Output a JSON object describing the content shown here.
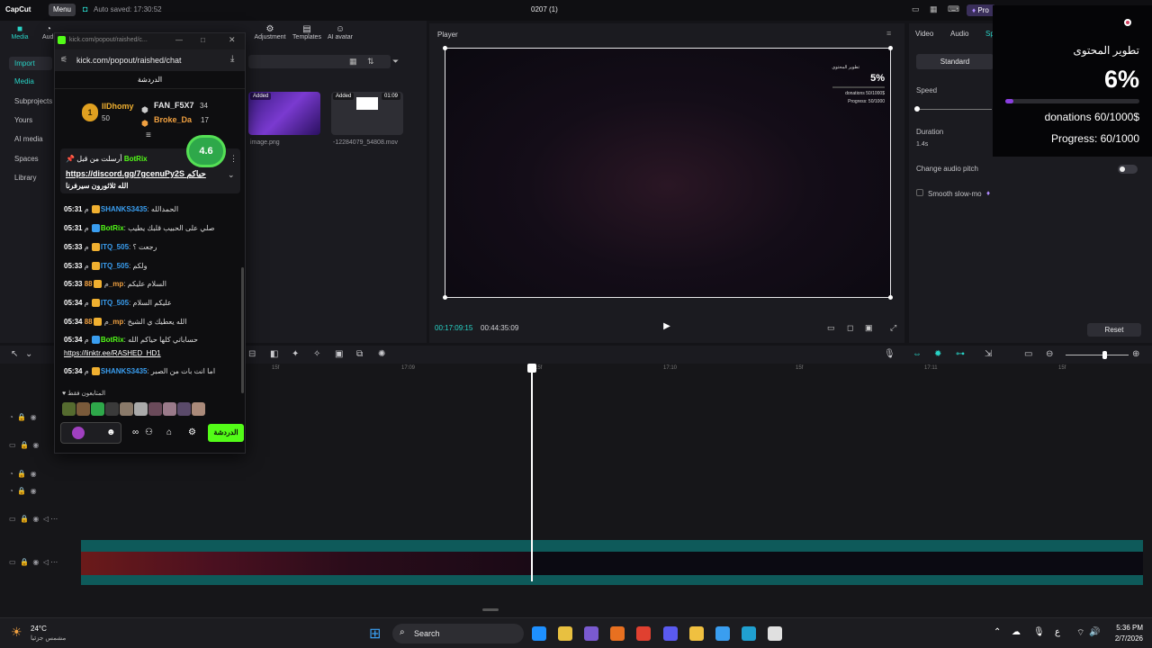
{
  "titlebar": {
    "app_name": "CapCut",
    "menu_label": "Menu",
    "autosave": "Auto saved: 17:30:52",
    "project_title": "0207 (1)",
    "pro_label": "Pro"
  },
  "toolbar": {
    "items": [
      {
        "label": "Media",
        "icon": "media-icon"
      },
      {
        "label": "Audi",
        "icon": "audio-icon"
      },
      {
        "label": "Adjustment",
        "icon": "adjustment-icon"
      },
      {
        "label": "Templates",
        "icon": "templates-icon"
      },
      {
        "label": "AI avatar",
        "icon": "ai-avatar-icon"
      }
    ]
  },
  "leftnav": {
    "items": [
      "Import",
      "Media",
      "Subprojects",
      "Yours",
      "AI media",
      "Spaces",
      "Library"
    ]
  },
  "media": {
    "thumbs": [
      {
        "badge": "Added",
        "name": "image.png",
        "duration": "",
        "color": "#5a2aa0"
      },
      {
        "badge": "Added",
        "name": "-12284079_54808.mov",
        "duration": "01:09",
        "color": "#2a2a30"
      }
    ]
  },
  "player": {
    "label": "Player",
    "current_time": "00:17:09:15",
    "total_time": "00:44:35:09",
    "preview": {
      "title": "تطوير المحتوى",
      "percent": "5%",
      "donations": "donations 50/1000$",
      "progress": "Progress: 50/1000"
    }
  },
  "rightpanel": {
    "tabs": [
      "Video",
      "Audio",
      "Sp"
    ],
    "standard_label": "Standard",
    "speed_label": "Speed",
    "duration_label": "Duration",
    "duration_value": "1.4s",
    "audio_pitch_label": "Change audio pitch",
    "smooth_label": "Smooth slow-mo",
    "reset_label": "Reset"
  },
  "overlay": {
    "title": "تطوير المحتوى",
    "percent": "6%",
    "progress_fraction": 0.06,
    "donations": "donations 60/1000$",
    "progress": "Progress: 60/1000",
    "bar_color": "#8a3ee0"
  },
  "timeline": {
    "ruler": [
      "15f",
      "17:09",
      "15f",
      "17:10",
      "15f",
      "17:11",
      "15f"
    ]
  },
  "chat": {
    "small_url": "kick.com/popout/raished/c...",
    "url": "kick.com/popout/raished/chat",
    "header": "الدردشة",
    "leaderboard": [
      {
        "rank": "1",
        "name": "IIDhomy",
        "count": "50",
        "color": "#f0b030"
      },
      {
        "rank": "",
        "name": "FAN_F5X7",
        "count": "34",
        "color": "#e8e8ea"
      },
      {
        "rank": "",
        "name": "Broke_Da",
        "count": "17",
        "color": "#f0a040"
      }
    ],
    "rating": "4.6",
    "pinned": {
      "line1_user": "BotRix",
      "line1_text": "أرسلت من قبل",
      "link": "https://discord.gg/7gcenuPy2S",
      "link_suffix": "حياكم",
      "line3": "الله ثلاثورون سيرفرنا"
    },
    "messages": [
      {
        "time": "05:31",
        "user": "SHANKS3435",
        "user_color": "#3a9ef0",
        "text": "الحمدالله",
        "badge_color": "#f0b030"
      },
      {
        "time": "05:31",
        "user": "BotRix",
        "user_color": "#53fc18",
        "text": "صلي على الحبيب قلبك يطيب",
        "badge_color": "#3a9ef0"
      },
      {
        "time": "05:33",
        "user": "ITQ_505",
        "user_color": "#3a9ef0",
        "text": "رجعت ؟",
        "badge_color": "#f0b030"
      },
      {
        "time": "05:33",
        "user": "ITQ_505",
        "user_color": "#3a9ef0",
        "text": "ولكم",
        "badge_color": "#f0b030"
      },
      {
        "time": "05:33",
        "user": "88_mp",
        "user_color": "#f0a040",
        "text": "السلام عليكم",
        "badge_color": "#f0b030"
      },
      {
        "time": "05:34",
        "user": "ITQ_505",
        "user_color": "#3a9ef0",
        "text": "عليكم السلام",
        "badge_color": "#f0b030"
      },
      {
        "time": "05:34",
        "user": "88_mp",
        "user_color": "#f0a040",
        "text": "الله يعطيك ي الشيخ",
        "badge_color": "#f0b030"
      },
      {
        "time": "05:34",
        "user": "BotRix",
        "user_color": "#53fc18",
        "text": "حساباتي كلها حياكم الله",
        "badge_color": "#3a9ef0"
      },
      {
        "time": "05:34",
        "user": "SHANKS3435",
        "user_color": "#3a9ef0",
        "text": "اما انت بات من الصبر",
        "badge_color": "#f0b030"
      }
    ],
    "link_message": "https://linktr.ee/RASHED_HD1",
    "followers_label": "المتابعون فقط",
    "send_label": "الدردشة",
    "avatars": [
      "#556b2f",
      "#7a5a3a",
      "#2ea84a",
      "#3a3a3a",
      "#8a7a6a",
      "#aaaaaa",
      "#6a4a5a",
      "#9a7a8a",
      "#5a4a6a",
      "#aa8a7a"
    ]
  },
  "taskbar": {
    "temp": "24°C",
    "weather": "مشمس جزئيا",
    "search": "Search",
    "time": "5:36 PM",
    "date": "2/7/2026",
    "apps": [
      "#1e90ff",
      "#e8c040",
      "#7a5ad0",
      "#e87020",
      "#e04030",
      "#5a5af0",
      "#f0c040",
      "#3a9ef0",
      "#20a0d0",
      "#e0e0e0",
      "#40c040"
    ]
  }
}
